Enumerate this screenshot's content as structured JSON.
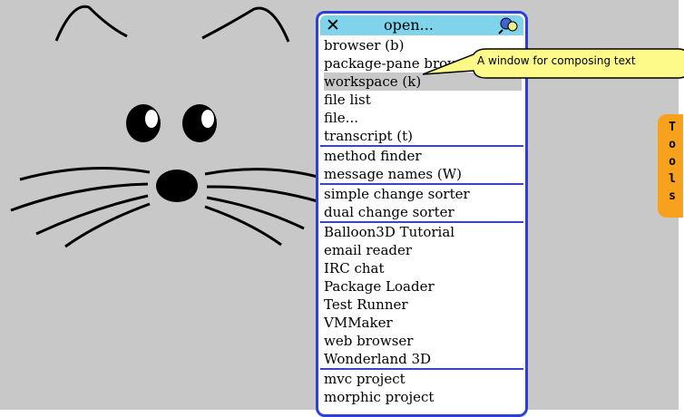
{
  "menu": {
    "title": "open...",
    "items": [
      "browser (b)",
      "package-pane browser",
      "workspace (k)",
      "file list",
      "file...",
      "transcript (t)",
      "method finder",
      "message names (W)",
      "simple change sorter",
      "dual change sorter",
      "Balloon3D Tutorial",
      "email reader",
      "IRC chat",
      "Package Loader",
      "Test Runner",
      "VMMaker",
      "web browser",
      "Wonderland 3D",
      "mvc project",
      "morphic project"
    ],
    "selected": "workspace (k)"
  },
  "tooltip": {
    "text": "A window for composing text"
  },
  "flap": {
    "label": [
      "T",
      "o",
      "o",
      "l",
      "s"
    ]
  },
  "icons": {
    "close": "close-icon",
    "pin": "pushpin-icon"
  },
  "colors": {
    "world": "#c8c8c8",
    "title_bar": "#7fd3ea",
    "menu_border": "#2b3fe0",
    "balloon": "#fdfa8a",
    "flap": "#f8a11c"
  }
}
